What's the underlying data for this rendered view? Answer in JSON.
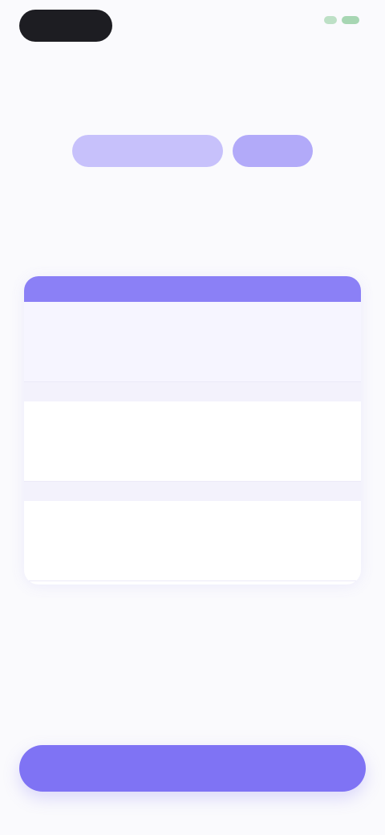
{
  "status_bar": {},
  "header": {
    "skip_label": ""
  },
  "badges": {
    "left": "",
    "right": ""
  },
  "headline": "",
  "plans": {
    "items": [
      {
        "name": "",
        "sub": "",
        "price": ""
      },
      {
        "name": "",
        "sub": "",
        "price": ""
      },
      {
        "name": "",
        "sub": "",
        "price": ""
      }
    ],
    "dividers": [
      "",
      ""
    ]
  },
  "tagline": "",
  "subline": "",
  "footnote": "",
  "cta_label": "",
  "colors": {
    "accent": "#7f73f4",
    "accent_light": "#c7c1fb",
    "background": "#fafafd"
  }
}
